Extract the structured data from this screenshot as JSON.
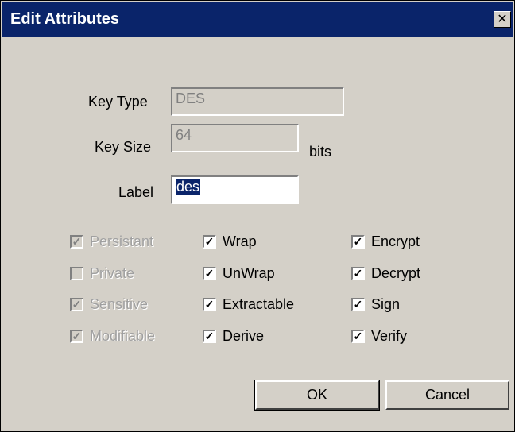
{
  "window": {
    "title": "Edit Attributes",
    "close_glyph": "✕"
  },
  "form": {
    "key_type_label": "Key Type",
    "key_type_value": "DES",
    "key_size_label": "Key Size",
    "key_size_value": "64",
    "bits_label": "bits",
    "label_label": "Label",
    "label_value": "des"
  },
  "checkboxes": {
    "col1": [
      {
        "label": "Persistant",
        "checked": true,
        "enabled": false
      },
      {
        "label": "Private",
        "checked": false,
        "enabled": false
      },
      {
        "label": "Sensitive",
        "checked": true,
        "enabled": false
      },
      {
        "label": "Modifiable",
        "checked": true,
        "enabled": false
      }
    ],
    "col2": [
      {
        "label": "Wrap",
        "checked": true,
        "enabled": true
      },
      {
        "label": "UnWrap",
        "checked": true,
        "enabled": true
      },
      {
        "label": "Extractable",
        "checked": true,
        "enabled": true
      },
      {
        "label": "Derive",
        "checked": true,
        "enabled": true
      }
    ],
    "col3": [
      {
        "label": "Encrypt",
        "checked": true,
        "enabled": true
      },
      {
        "label": "Decrypt",
        "checked": true,
        "enabled": true
      },
      {
        "label": "Sign",
        "checked": true,
        "enabled": true
      },
      {
        "label": "Verify",
        "checked": true,
        "enabled": true
      }
    ]
  },
  "buttons": {
    "ok": "OK",
    "cancel": "Cancel"
  },
  "colors": {
    "titlebar": "#0a246a",
    "face": "#d4d0c8"
  }
}
